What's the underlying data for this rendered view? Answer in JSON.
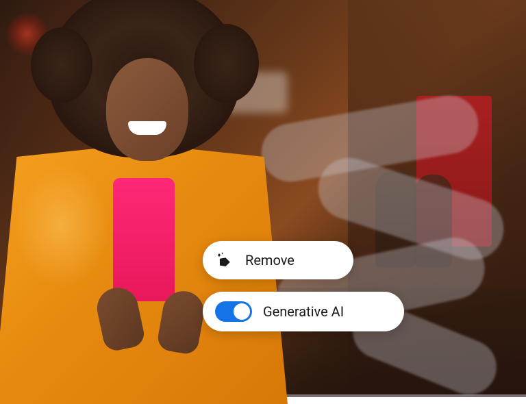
{
  "controls": {
    "remove": {
      "label": "Remove",
      "icon": "eraser-sparkle-icon"
    },
    "generative_ai": {
      "label": "Generative AI",
      "toggle_on": true,
      "toggle_color": "#1473e6"
    }
  }
}
